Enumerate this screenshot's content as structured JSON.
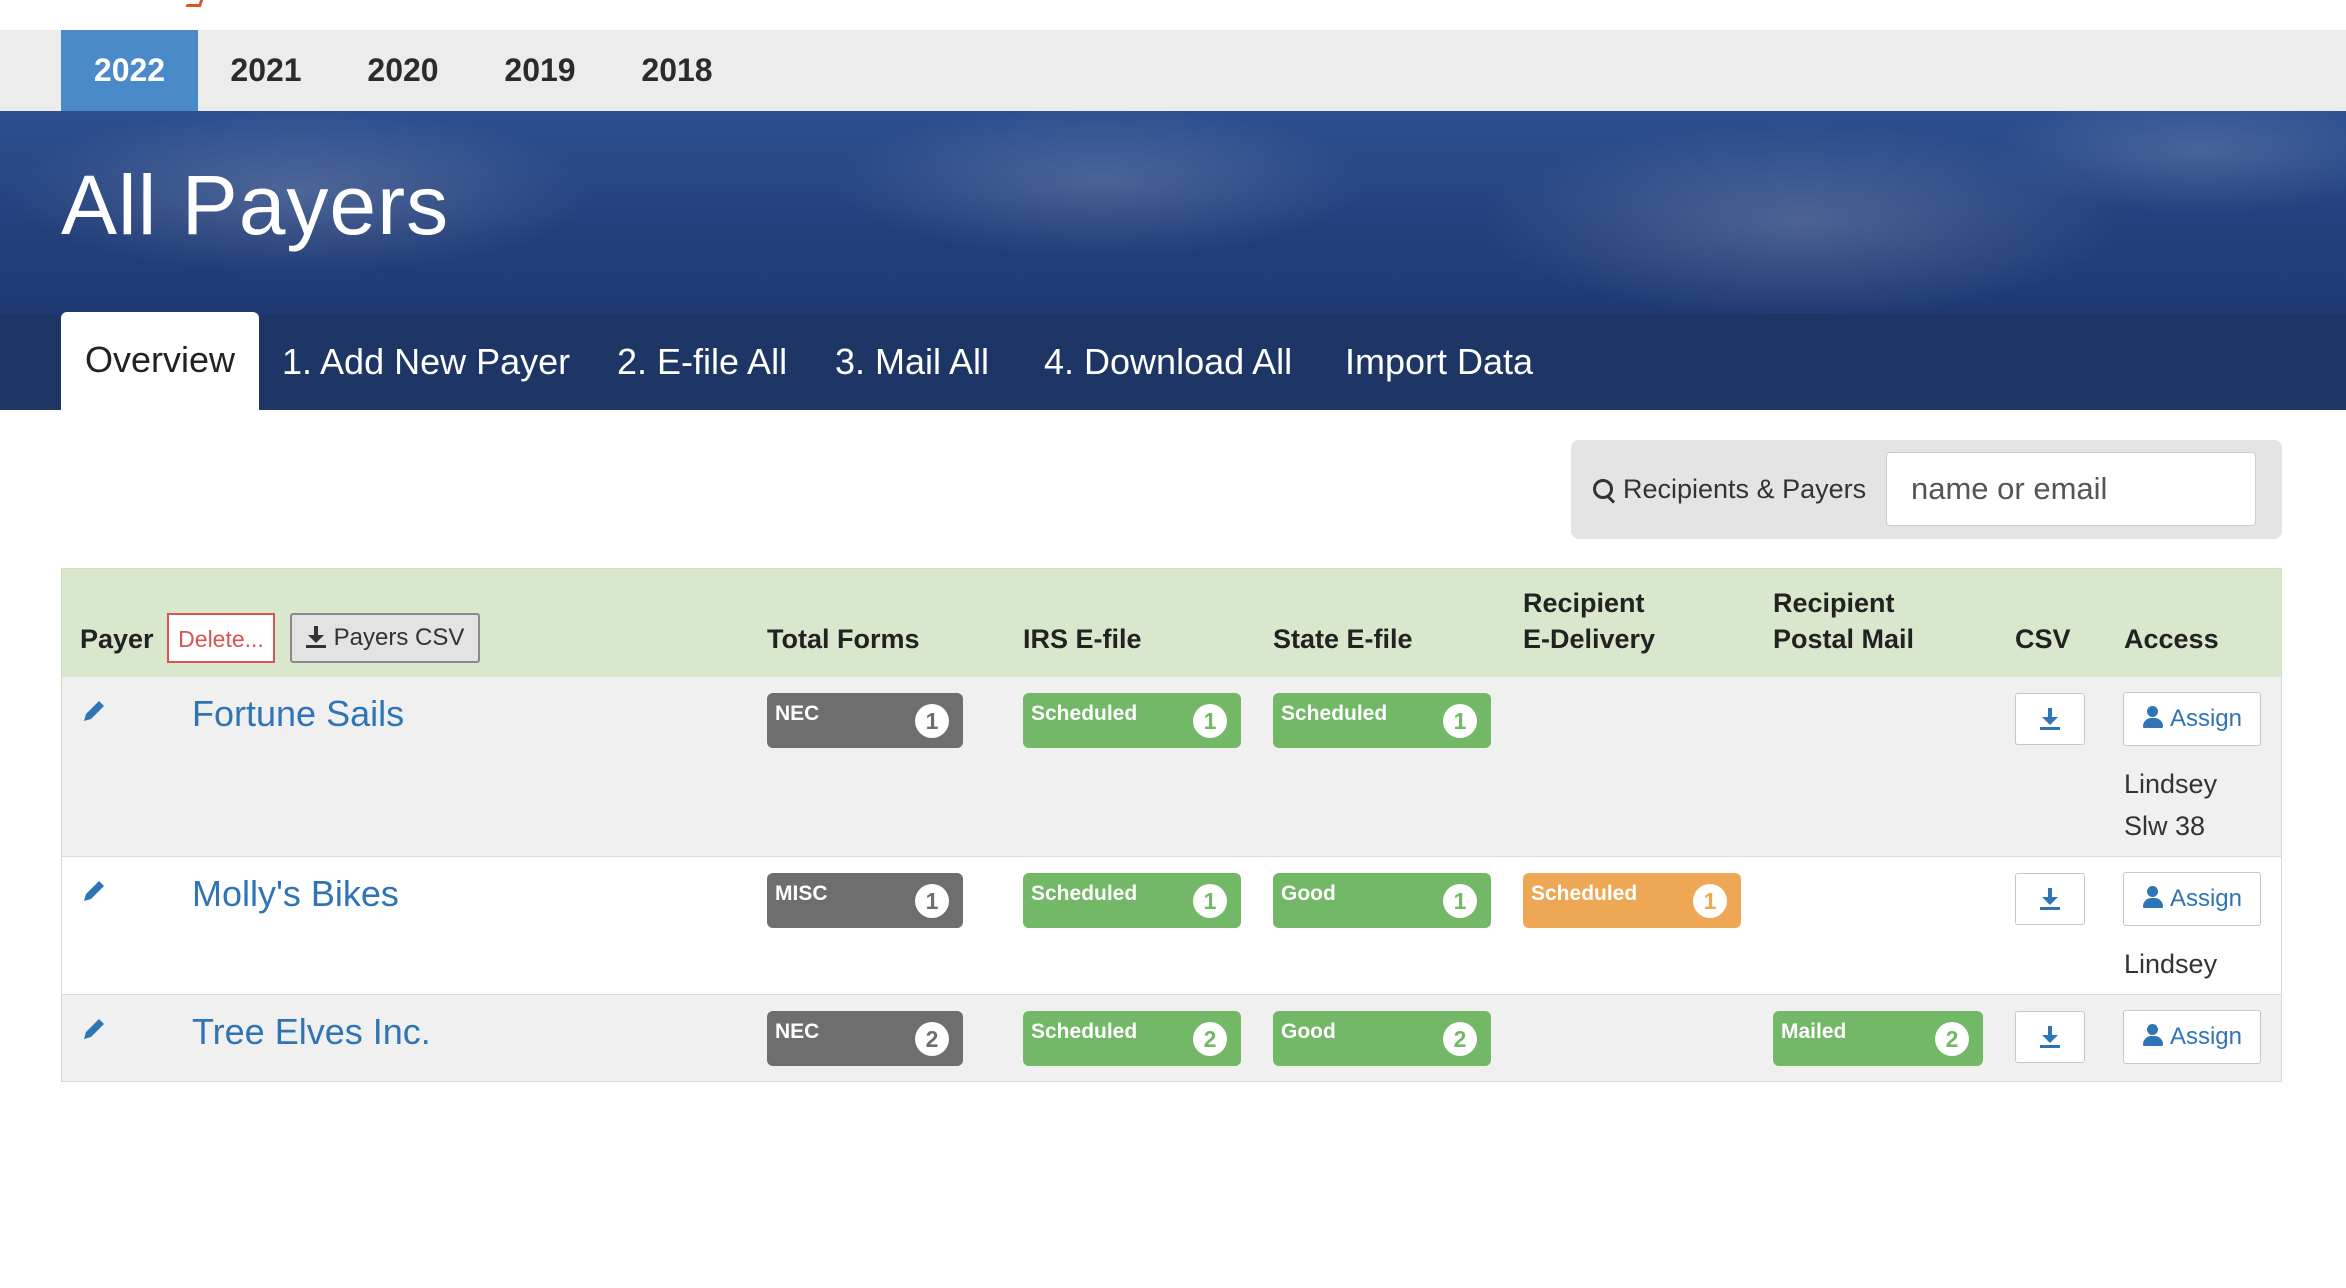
{
  "years": [
    "2022",
    "2021",
    "2020",
    "2019",
    "2018"
  ],
  "active_year": "2022",
  "page_title": "All Payers",
  "nav": {
    "tabs": [
      "Overview",
      "1. Add New Payer",
      "2. E-file All",
      "3. Mail All",
      "4. Download All",
      "Import Data"
    ]
  },
  "search": {
    "label": "Recipients & Payers",
    "placeholder": "name or email"
  },
  "table": {
    "headers": {
      "payer": "Payer",
      "delete": "Delete...",
      "payers_csv": "Payers CSV",
      "total_forms": "Total Forms",
      "irs_efile": "IRS E-file",
      "state_efile": "State E-file",
      "recipient_edelivery": [
        "Recipient",
        "E-Delivery"
      ],
      "recipient_postal": [
        "Recipient",
        "Postal Mail"
      ],
      "csv": "CSV",
      "access": "Access"
    },
    "assign_label": "Assign",
    "rows": [
      {
        "name": "Fortune Sails",
        "total_forms": {
          "label": "NEC",
          "count": "1"
        },
        "irs": {
          "label": "Scheduled",
          "count": "1"
        },
        "state": {
          "label": "Scheduled",
          "count": "1"
        },
        "access": [
          "Lindsey",
          "Slw 38"
        ]
      },
      {
        "name": "Molly's Bikes",
        "total_forms": {
          "label": "MISC",
          "count": "1"
        },
        "irs": {
          "label": "Scheduled",
          "count": "1"
        },
        "state": {
          "label": "Good",
          "count": "1"
        },
        "edelivery": {
          "label": "Scheduled",
          "count": "1"
        },
        "access": [
          "Lindsey"
        ]
      },
      {
        "name": "Tree Elves Inc.",
        "total_forms": {
          "label": "NEC",
          "count": "2"
        },
        "irs": {
          "label": "Scheduled",
          "count": "2"
        },
        "state": {
          "label": "Good",
          "count": "2"
        },
        "postal": {
          "label": "Mailed",
          "count": "2"
        }
      }
    ]
  },
  "colors": {
    "accent": "#4a8ac9",
    "link": "#2f74b5",
    "green": "#72b867",
    "orange": "#eea855",
    "gray": "#6e6e6e",
    "header_bg": "#d9e8cd"
  }
}
